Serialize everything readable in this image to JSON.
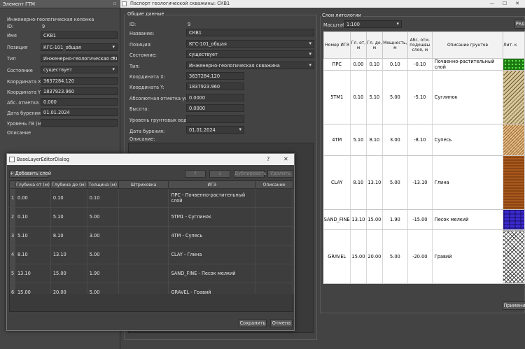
{
  "dock": {
    "title": "Элемент ГТМ",
    "heading": "Инженерно-геологическая колонка",
    "id_label": "ID:",
    "id_value": "9",
    "name_label": "Имя",
    "name_value": "СКВ1",
    "position_label": "Позиция",
    "position_value": "КГС-101_общая",
    "type_label": "Тип",
    "type_value": "Инженерно-геологическая скважин",
    "state_label": "Состояние",
    "state_value": "существует",
    "x_label": "Координата X",
    "x_value": "3637284.120",
    "y_label": "Координата Y",
    "y_value": "1837923.960",
    "abs_label": "Абс. отметка",
    "abs_value": "0.000",
    "date_label": "Дата бурения",
    "date_value": "01.01.2024",
    "gw_label": "Уровень ГВ (м)",
    "gw_value": "",
    "desc_label": "Описание"
  },
  "main": {
    "title": "Паспорт геологической скважины: СКВ1",
    "general": {
      "group_title": "Общие данные",
      "id_label": "ID:",
      "id_value": "9",
      "name_label": "Название:",
      "name_value": "СКВ1",
      "position_label": "Позиция:",
      "position_value": "КГС-101_общая",
      "state_label": "Состояние:",
      "state_value": "существует",
      "type_label": "Тип:",
      "type_value": "Инженерно-геологическая скважина",
      "x_label": "Координата X:",
      "x_value": "3637284.120",
      "y_label": "Координата Y:",
      "y_value": "1837923.960",
      "abs_label": "Абсолютная отметка устья:",
      "abs_value": "0.0000",
      "height_label": "Высота:",
      "height_value": "0.0000",
      "gw_label": "Уровень грунтовых вод (м):",
      "gw_value": "",
      "date_label": "Дата бурения:",
      "date_value": "01.01.2024",
      "desc_label": "Описание:"
    },
    "litho": {
      "group_title": "Слои литологии",
      "scale_label": "Масштаб:",
      "scale_value": "1:100",
      "edit_button": "Ред",
      "headers": [
        "Номер ИГЭ",
        "Гл. от, м",
        "Гл. до, м",
        "Мощность, м",
        "Абс. отм. подошвы слоя, м",
        "Описание грунтов",
        "Лит. к"
      ],
      "rows": [
        {
          "n": "ПРС",
          "from": "0.00",
          "to": "0.10",
          "thick": "0.10",
          "abs": "-0.10",
          "desc": "Почвенно-растительный слой"
        },
        {
          "n": "5TM1",
          "from": "0.10",
          "to": "5.10",
          "thick": "5.00",
          "abs": "-5.10",
          "desc": "Суглинок"
        },
        {
          "n": "4TM",
          "from": "5.10",
          "to": "8.10",
          "thick": "3.00",
          "abs": "-8.10",
          "desc": "Супесь"
        },
        {
          "n": "CLAY",
          "from": "8.10",
          "to": "13.10",
          "thick": "5.00",
          "abs": "-13.10",
          "desc": "Глина"
        },
        {
          "n": "SAND_FINE",
          "from": "13.10",
          "to": "15.00",
          "thick": "1.90",
          "abs": "-15.00",
          "desc": "Песок мелкий"
        },
        {
          "n": "GRAVEL",
          "from": "15.00",
          "to": "20.00",
          "thick": "5.00",
          "abs": "-20.00",
          "desc": "Гравий"
        }
      ],
      "apply_button": "Примени"
    }
  },
  "dialog": {
    "title": "BaseLayerEditorDialog",
    "help": "?",
    "close": "✕",
    "add_button": "+ Добавить слой",
    "up_button": "↑",
    "down_button": "↓",
    "duplicate_button": "Дублировать",
    "delete_button": "Удалить",
    "headers": [
      "",
      "Глубина от (м)",
      "Глубина до (м)",
      "Толщина (м)",
      "Штриховка",
      "ИГЭ",
      "Описание"
    ],
    "rows": [
      {
        "num": "1",
        "from": "0.00",
        "to": "0.10",
        "thick": "0.10",
        "ige": "ПРС - Почвенно-растительный слой",
        "desc": ""
      },
      {
        "num": "2",
        "from": "0.10",
        "to": "5.10",
        "thick": "5.00",
        "ige": "5TM1 - Суглинок",
        "desc": ""
      },
      {
        "num": "3",
        "from": "5.10",
        "to": "8.10",
        "thick": "3.00",
        "ige": "4TM - Супесь",
        "desc": ""
      },
      {
        "num": "4",
        "from": "8.10",
        "to": "13.10",
        "thick": "5.00",
        "ige": "CLAY - Глина",
        "desc": ""
      },
      {
        "num": "5",
        "from": "13.10",
        "to": "15.00",
        "thick": "1.90",
        "ige": "SAND_FINE - Песок мелкий",
        "desc": ""
      },
      {
        "num": "6",
        "from": "15.00",
        "to": "20.00",
        "thick": "5.00",
        "ige": "GRAVEL - Гравий",
        "desc": ""
      }
    ],
    "save_button": "Сохранить",
    "cancel_button": "Отмена"
  },
  "patterns": [
    "p-prs",
    "p-stm",
    "p-4tm",
    "p-clay",
    "p-sand",
    "p-gravel"
  ]
}
